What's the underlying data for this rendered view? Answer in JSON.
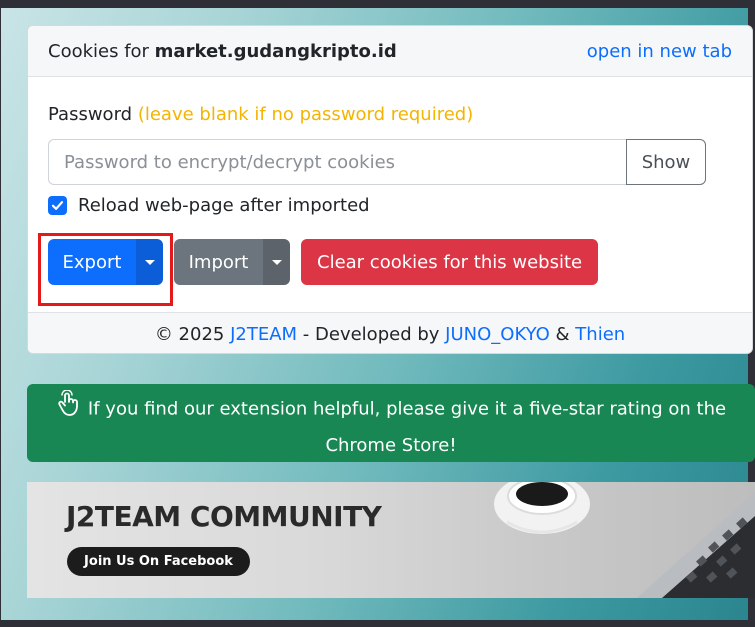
{
  "header": {
    "prefix": "Cookies for ",
    "domain": "market.gudangkripto.id",
    "open_tab": "open in new tab"
  },
  "password": {
    "label": "Password",
    "hint": "(leave blank if no password required)",
    "placeholder": "Password to encrypt/decrypt cookies",
    "value": "",
    "show_label": "Show"
  },
  "reload": {
    "label": "Reload web-page after imported",
    "checked": true
  },
  "buttons": {
    "export": "Export",
    "import": "Import",
    "clear": "Clear cookies for this website"
  },
  "footer": {
    "copyright": "© 2025 ",
    "team": "J2TEAM",
    "developed": " - Developed by ",
    "dev1": "JUNO_OKYO",
    "amp": " & ",
    "dev2": "Thien"
  },
  "rating": {
    "text": "If you find our extension helpful, please give it a five-star rating on the Chrome Store!"
  },
  "banner": {
    "title": "J2TEAM COMMUNITY",
    "button": "Join Us On Facebook"
  },
  "colors": {
    "primary": "#0d6efd",
    "secondary": "#6c757d",
    "danger": "#dc3545",
    "success": "#198754",
    "hint": "#f4b400",
    "highlight": "#e3191a"
  },
  "icons": [
    "checkmark-icon",
    "caret-down-icon",
    "hand-tap-icon"
  ]
}
